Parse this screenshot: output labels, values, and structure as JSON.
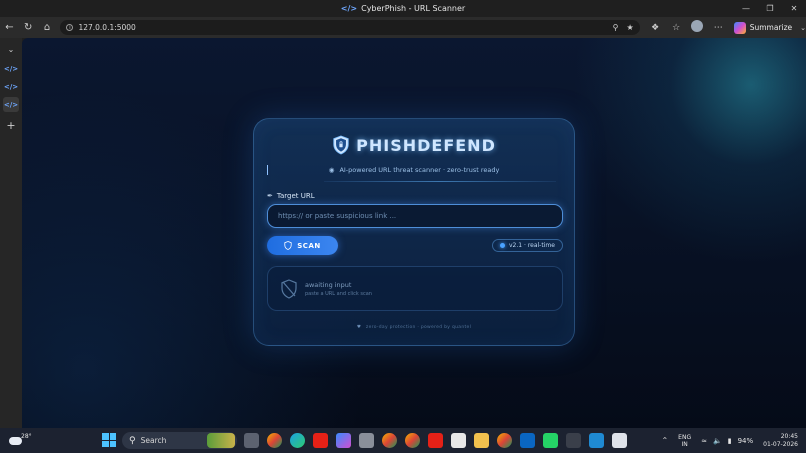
{
  "window": {
    "title": "CyberPhish - URL Scanner",
    "controls": [
      "—",
      "❐",
      "✕"
    ]
  },
  "browser": {
    "url": "127.0.0.1:5000",
    "summarize_label": "Summarize"
  },
  "app": {
    "brand": "PHISHDEFEND",
    "tagline": "AI-powered URL threat scanner · zero-trust ready",
    "field_label": "Target URL",
    "input_placeholder": "https:// or paste suspicious link ...",
    "input_value": "",
    "scan_label": "SCAN",
    "version_badge": "v2.1 · real-time",
    "result_title": "awaiting input",
    "result_hint": "paste a URL and click scan",
    "footer": "zero-day protection · powered by quantel"
  },
  "taskbar": {
    "temperature": "28°",
    "search_label": "Search",
    "lang_top": "ENG",
    "lang_bottom": "IN",
    "battery": "94%",
    "time": "20:45",
    "date": "01-07-2026"
  },
  "colors": {
    "accent": "#3c86f0",
    "brand_glow": "#cfe6ff",
    "background": "#071022"
  },
  "icons": {
    "brand": "shield-lock-icon",
    "scan": "shield-icon",
    "result": "shield-slash-icon",
    "field": "paperclip-icon",
    "footer": "shield-icon"
  }
}
